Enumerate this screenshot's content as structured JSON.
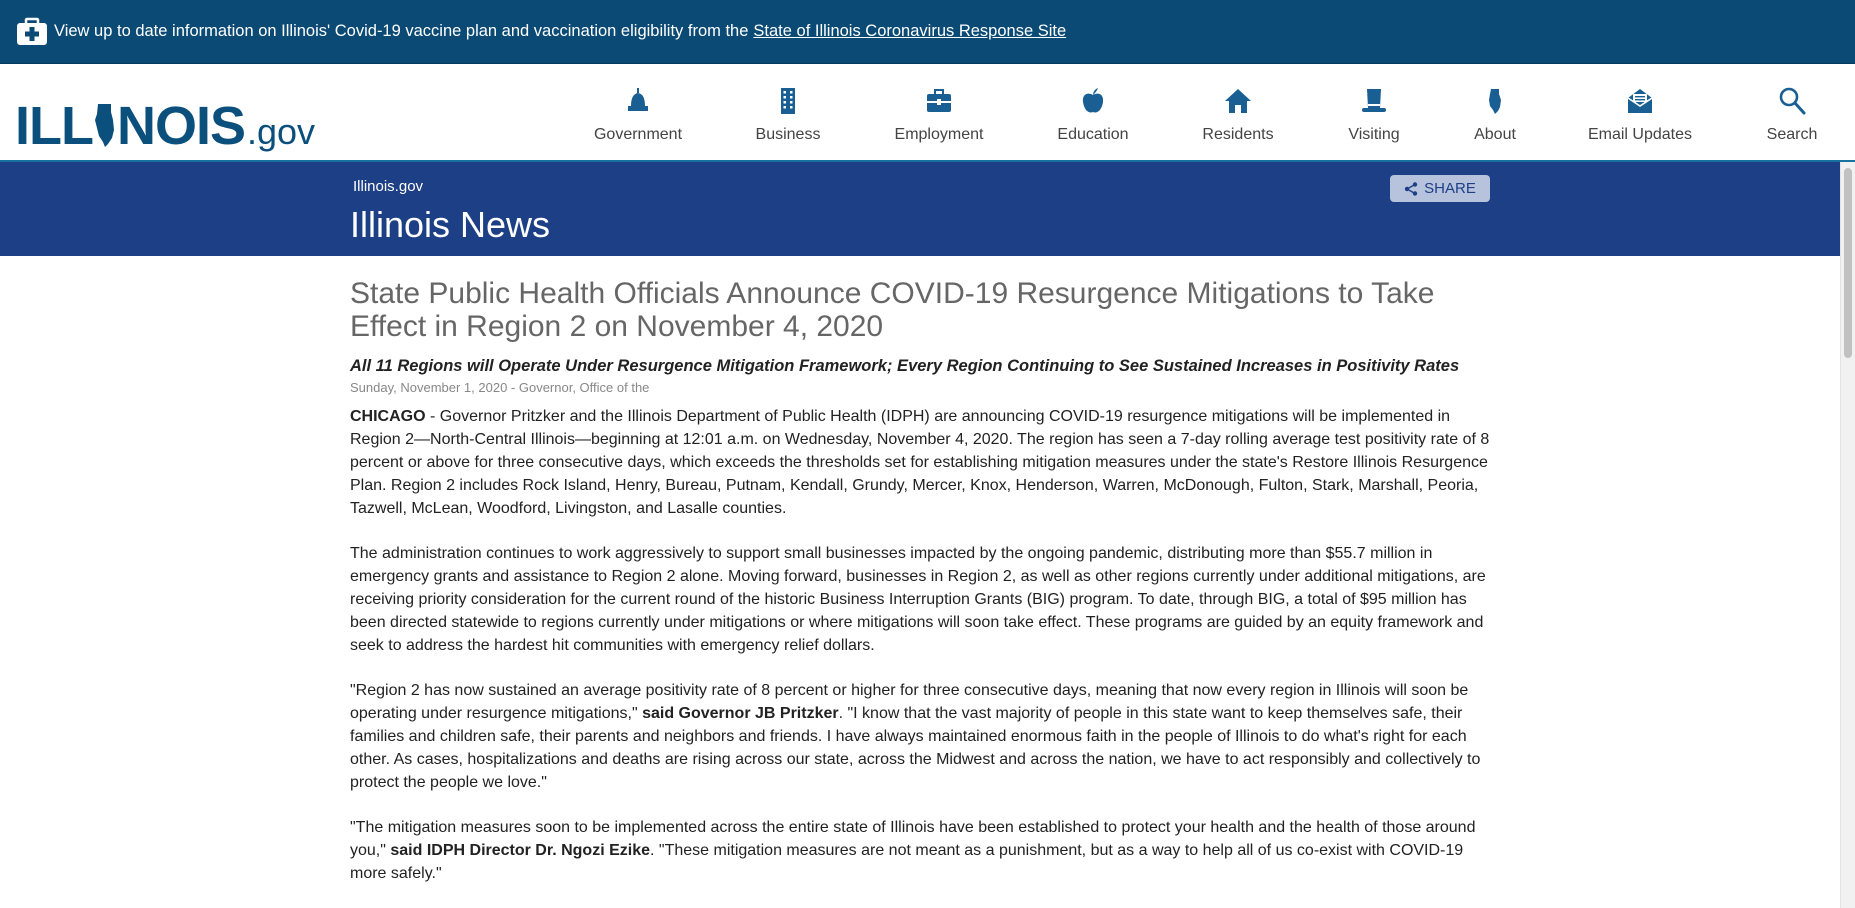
{
  "alert": {
    "text": "View up to date information on Illinois' Covid-19 vaccine plan and vaccination eligibility from the",
    "link": "State of Illinois Coronavirus Response Site"
  },
  "logo": {
    "ill": "ILL",
    "nois": "NOIS",
    "gov": ".gov"
  },
  "nav": {
    "items": [
      {
        "label": "Government",
        "icon": "capitol-dome-icon"
      },
      {
        "label": "Business",
        "icon": "building-icon"
      },
      {
        "label": "Employment",
        "icon": "briefcase-icon"
      },
      {
        "label": "Education",
        "icon": "apple-icon"
      },
      {
        "label": "Residents",
        "icon": "home-icon"
      },
      {
        "label": "Visiting",
        "icon": "lincoln-hat-icon"
      },
      {
        "label": "About",
        "icon": "illinois-state-icon"
      },
      {
        "label": "Email Updates",
        "icon": "envelope-icon"
      },
      {
        "label": "Search",
        "icon": "search-icon"
      }
    ]
  },
  "band": {
    "breadcrumb": "Illinois.gov",
    "title": "Illinois News",
    "share_label": "SHARE"
  },
  "article": {
    "headline": "State Public Health Officials Announce COVID-19 Resurgence Mitigations to Take Effect in Region 2 on November 4, 2020",
    "subhead": "All 11 Regions will Operate Under Resurgence Mitigation Framework; Every Region Continuing to See Sustained Increases in Positivity Rates",
    "dateline": "Sunday, November 1, 2020 - Governor, Office of the",
    "p1_lead": "CHICAGO",
    "p1_text": " - Governor Pritzker and the Illinois Department of Public Health (IDPH) are announcing COVID-19 resurgence mitigations will be implemented in Region 2—North-Central Illinois—beginning at 12:01 a.m. on Wednesday, November 4, 2020. The region has seen a 7-day rolling average test positivity rate of 8 percent or above for three consecutive days, which exceeds the thresholds set for establishing mitigation measures under the state's Restore Illinois Resurgence Plan. Region 2 includes Rock Island, Henry, Bureau, Putnam, Kendall, Grundy, Mercer, Knox, Henderson, Warren, McDonough, Fulton, Stark, Marshall, Peoria, Tazwell, McLean, Woodford, Livingston, and Lasalle counties.",
    "p2": "The administration continues to work aggressively to support small businesses impacted by the ongoing pandemic, distributing more than $55.7 million in emergency grants and assistance to Region 2 alone. Moving forward, businesses in Region 2, as well as other regions currently under additional mitigations, are receiving priority consideration for the current round of the historic Business Interruption Grants (BIG) program. To date, through BIG, a total of $95 million has been directed statewide to regions currently under mitigations or where mitigations will soon take effect. These programs are guided by an equity framework and seek to address the hardest hit communities with emergency relief dollars.",
    "p3_a": "\"Region 2 has now sustained an average positivity rate of 8 percent or higher for three consecutive days, meaning that now every region in Illinois will soon be operating under resurgence mitigations,\" ",
    "p3_bold": "said Governor JB Pritzker",
    "p3_b": ". \"I know that the vast majority of people in this state want to keep themselves safe, their families and children safe, their parents and neighbors and friends. I have always maintained enormous faith in the people of Illinois to do what's right for each other. As cases, hospitalizations and deaths are rising across our state, across the Midwest and across the nation, we have to act responsibly and collectively to protect the people we love.\"",
    "p4_a": "\"The mitigation measures soon to be implemented across the entire state of Illinois have been established to protect your health and the health of those around you,\" ",
    "p4_bold": "said IDPH Director Dr. Ngozi Ezike",
    "p4_b": ".  \"These mitigation measures are not meant as a punishment, but as a way to help all of us co-exist with COVID-19 more safely.\""
  },
  "colors": {
    "alert_bg": "#0a4a75",
    "logo_blue": "#0b4f7c",
    "band_bg": "#1d3f86",
    "icon_blue": "#1a5f94"
  }
}
